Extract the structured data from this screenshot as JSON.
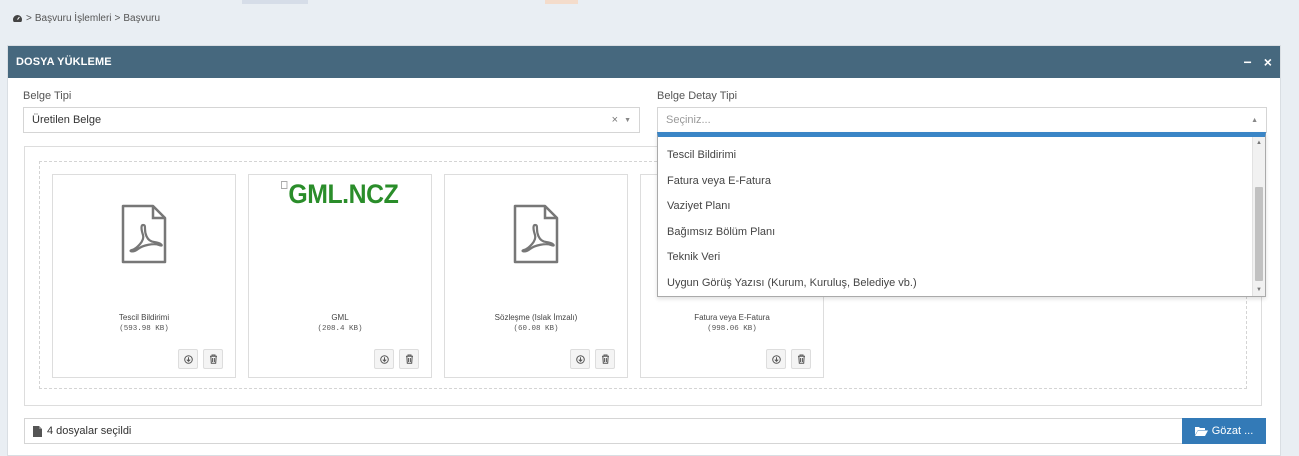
{
  "breadcrumb": {
    "icon": "dashboard-icon",
    "separator": ">",
    "items": [
      "Başvuru İşlemleri",
      "Başvuru"
    ]
  },
  "panel": {
    "title": "DOSYA YÜKLEME",
    "minimize": "−",
    "close": "×"
  },
  "belge_tipi": {
    "label": "Belge Tipi",
    "value": "Üretilen Belge",
    "clear": "×",
    "arrow": "▼"
  },
  "belge_detay_tipi": {
    "label": "Belge Detay Tipi",
    "placeholder": "Seçiniz...",
    "arrow": "▲",
    "options": [
      "Tescil Bildirimi",
      "Fatura veya E-Fatura",
      "Vaziyet Planı",
      "Bağımsız Bölüm Planı",
      "Teknik Veri",
      "Uygun Görüş Yazısı (Kurum, Kuruluş, Belediye vb.)"
    ]
  },
  "files": [
    {
      "name": "Tescil Bildirimi",
      "size": "(593.98 KB)",
      "thumb": "pdf-icon"
    },
    {
      "name": "GML",
      "size": "(208.4 KB)",
      "thumb": "broken-image",
      "alt": "GML.NCZ"
    },
    {
      "name": "Sözleşme (Islak İmzalı)",
      "size": "(60.08 KB)",
      "thumb": "pdf-icon"
    },
    {
      "name": "Fatura veya E-Fatura",
      "size": "(998.06 KB)",
      "thumb": "pdf-icon"
    }
  ],
  "file_bar": {
    "icon": "file-icon",
    "text": "4 dosyalar seçildi",
    "browse_label": "Gözat ...",
    "browse_icon": "folder-open-icon"
  },
  "colors": {
    "header": "#46687e",
    "accent": "#3a85c6",
    "browse_button": "#337ab7",
    "gml_text": "#2a8d2a"
  }
}
